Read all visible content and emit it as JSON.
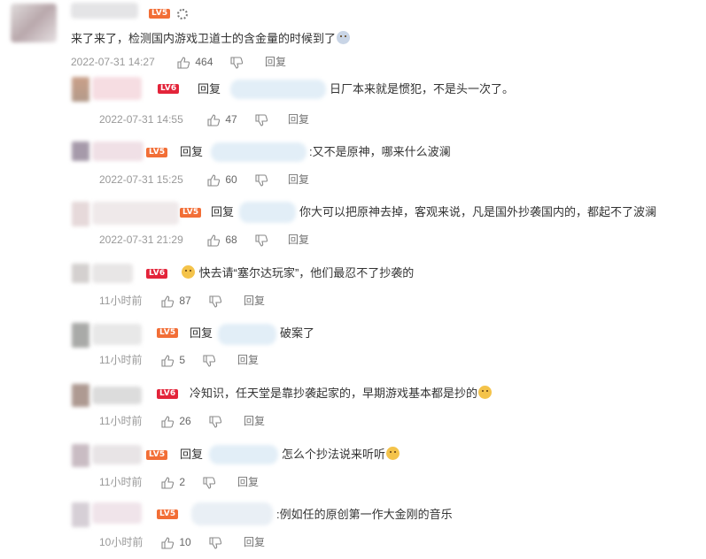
{
  "comments": [
    {
      "text": "来了来了，检测国内游戏卫道士的含金量的时候到了",
      "time": "2022-07-31 14:27",
      "likes": "464",
      "reply_label": "回复",
      "level": "LV5",
      "level_color": "#f26e36"
    },
    {
      "reply_prefix": "回复",
      "text": "日厂本来就是惯犯，不是头一次了。",
      "time": "2022-07-31 14:55",
      "likes": "47",
      "reply_label": "回复",
      "level": "LV6",
      "level_color": "#e3243a"
    },
    {
      "reply_prefix": "回复",
      "text": ":又不是原神，哪来什么波澜",
      "time": "2022-07-31 15:25",
      "likes": "60",
      "reply_label": "回复",
      "level": "LV5",
      "level_color": "#f26e36"
    },
    {
      "reply_prefix": "回复",
      "text": "你大可以把原神去掉，客观来说，凡是国外抄袭国内的，都起不了波澜",
      "time": "2022-07-31 21:29",
      "likes": "68",
      "reply_label": "回复",
      "level": "LV5",
      "level_color": "#f26e36"
    },
    {
      "text": "快去请“塞尔达玩家”，他们最忍不了抄袭的",
      "time": "11小时前",
      "likes": "87",
      "reply_label": "回复",
      "level": "LV6",
      "level_color": "#e3243a"
    },
    {
      "reply_prefix": "回复",
      "text": "破案了",
      "time": "11小时前",
      "likes": "5",
      "reply_label": "回复",
      "level": "LV5",
      "level_color": "#f26e36"
    },
    {
      "text": "冷知识，任天堂是靠抄袭起家的，早期游戏基本都是抄的",
      "time": "11小时前",
      "likes": "26",
      "reply_label": "回复",
      "level": "LV6",
      "level_color": "#e3243a"
    },
    {
      "reply_prefix": "回复",
      "text": "怎么个抄法说来听听",
      "time": "11小时前",
      "likes": "2",
      "reply_label": "回复",
      "level": "LV5",
      "level_color": "#f26e36"
    },
    {
      "text": ":例如任的原创第一作大金刚的音乐",
      "time": "10小时前",
      "likes": "10",
      "reply_label": "回复",
      "level": "LV5",
      "level_color": "#f26e36"
    }
  ]
}
